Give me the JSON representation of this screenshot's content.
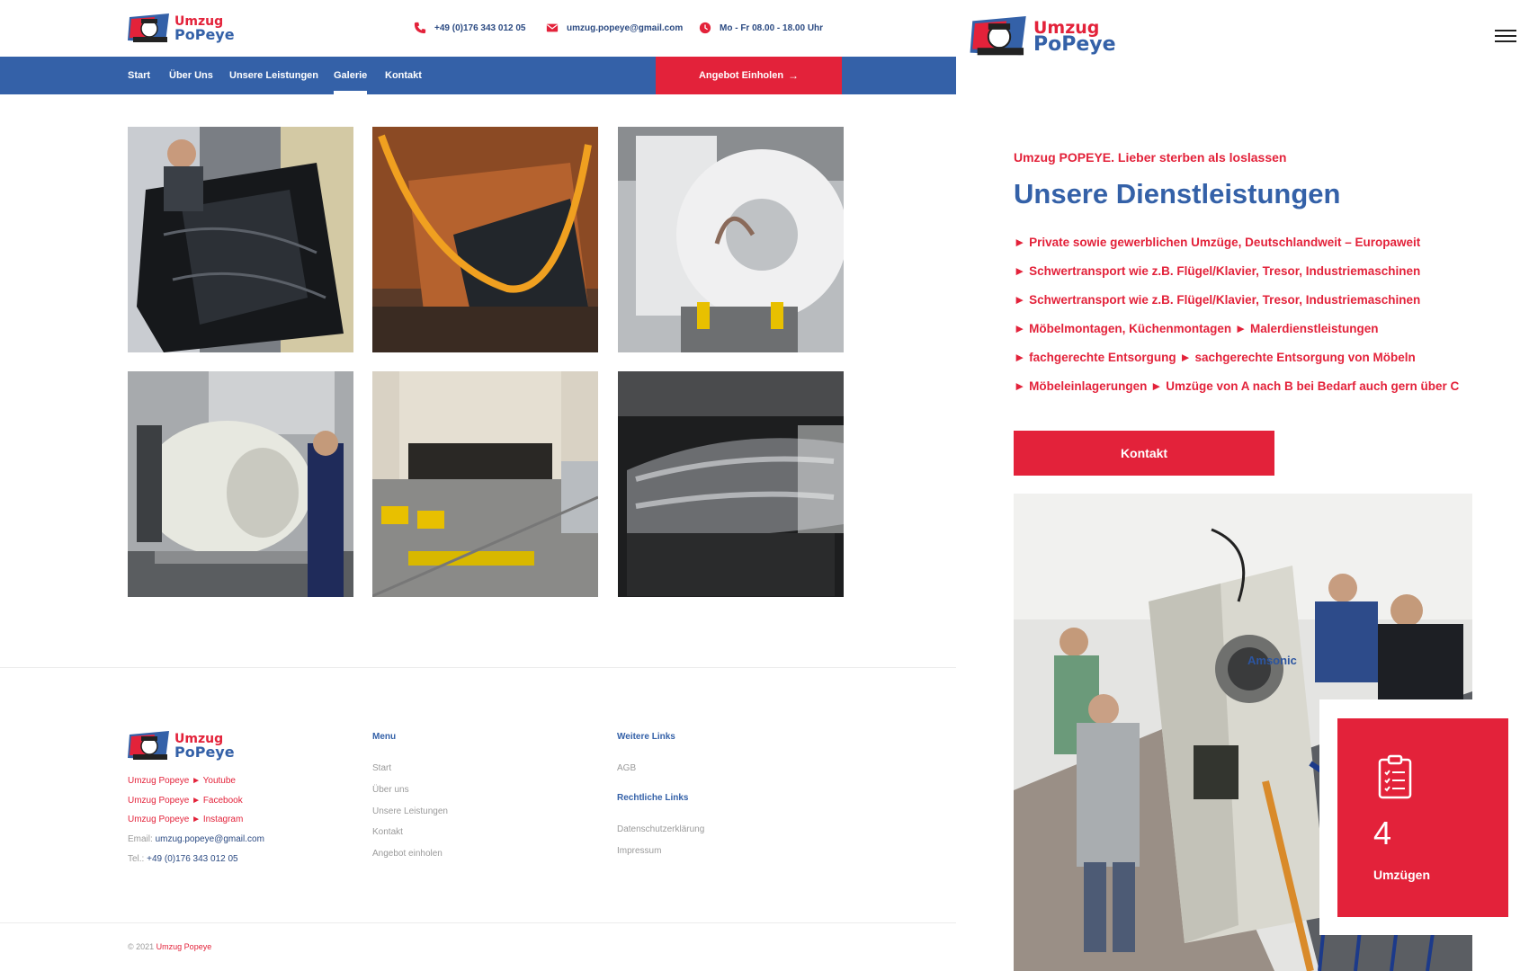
{
  "brand": {
    "logo_line1": "Umzug",
    "logo_line2": "PoPeye",
    "red": "#e3223a",
    "blue": "#3461a8"
  },
  "header": {
    "phone": "+49 (0)176 343 012 05",
    "email": "umzug.popeye@gmail.com",
    "hours": "Mo - Fr 08.00 - 18.00 Uhr",
    "phone_icon": "phone-icon",
    "email_icon": "envelope-icon",
    "hours_icon": "clock-icon"
  },
  "nav": {
    "items": [
      {
        "label": "Start",
        "active": false
      },
      {
        "label": "Über Uns",
        "active": false
      },
      {
        "label": "Unsere Leistungen",
        "active": false
      },
      {
        "label": "Galerie",
        "active": true
      },
      {
        "label": "Kontakt",
        "active": false
      }
    ],
    "cta_label": "Angebot Einholen"
  },
  "gallery": {
    "images": [
      "photo-wrapped-furniture",
      "photo-strapped-piano",
      "photo-medical-scanner",
      "photo-industrial-drum",
      "photo-truck-loading",
      "photo-wrapped-sofa"
    ]
  },
  "footer": {
    "social": [
      "Umzug Popeye ► Youtube",
      "Umzug Popeye ► Facebook",
      "Umzug Popeye ► Instagram"
    ],
    "email_label": "Email:",
    "email_value": "umzug.popeye@gmail.com",
    "tel_label": "Tel.:",
    "tel_value": "+49 (0)176 343 012 05",
    "menu_title": "Menu",
    "menu_items": [
      "Start",
      "Über uns",
      "Unsere Leistungen",
      "Kontakt",
      "Angebot einholen"
    ],
    "links_title": "Weitere Links",
    "links_items": [
      "AGB"
    ],
    "legal_title": "Rechtliche Links",
    "legal_items": [
      "Datenschutzerklärung",
      "Impressum"
    ],
    "copyright_prefix": "© 2021",
    "copyright_brand": "Umzug Popeye"
  },
  "services": {
    "tagline": "Umzug POPEYE. Lieber sterben als loslassen",
    "title": "Unsere Dienstleistungen",
    "items": [
      "► Private sowie gewerblichen Umzüge, Deutschlandweit – Europaweit",
      "► Schwertransport wie z.B. Flügel/Klavier, Tresor, Industriemaschinen",
      "► Schwertransport wie z.B. Flügel/Klavier, Tresor, Industriemaschinen",
      "► Möbelmontagen, Küchenmontagen ► Malerdienstleistungen",
      "► fachgerechte Entsorgung ► sachgerechte Entsorgung von Möbeln",
      "► Möbeleinlagerungen ► Umzüge von A nach B bei Bedarf auch gern über C"
    ],
    "kontakt_label": "Kontakt"
  },
  "hero": {
    "machine_label": "Amsonic"
  },
  "counter": {
    "value": "4",
    "label": "Umzügen",
    "icon": "clipboard-icon"
  }
}
